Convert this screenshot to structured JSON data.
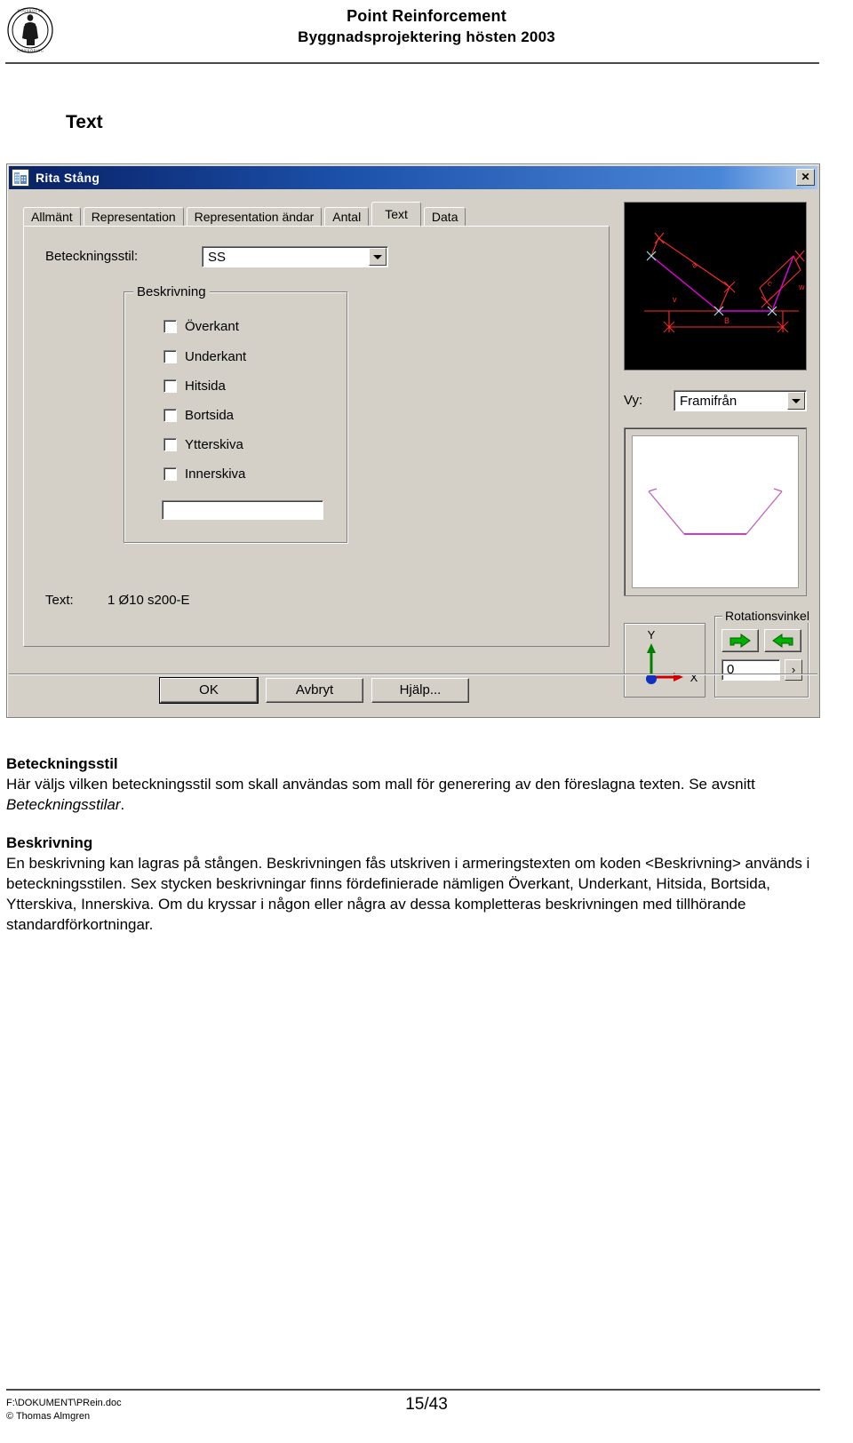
{
  "header": {
    "title_line1": "Point Reinforcement",
    "title_line2": "Byggnadsprojektering hösten 2003",
    "logo_name": "university-seal-logo"
  },
  "section": {
    "heading": "Text"
  },
  "dialog": {
    "title": "Rita Stång",
    "close_label": "✕",
    "tabs": [
      {
        "label": "Allmänt",
        "active": false
      },
      {
        "label": "Representation",
        "active": false
      },
      {
        "label": "Representation ändar",
        "active": false
      },
      {
        "label": "Antal",
        "active": false
      },
      {
        "label": "Text",
        "active": true
      },
      {
        "label": "Data",
        "active": false
      }
    ],
    "style": {
      "label": "Beteckningsstil:",
      "value": "SS",
      "placeholder": ""
    },
    "beskrivning": {
      "legend": "Beskrivning",
      "checkboxes": [
        {
          "label": "Överkant",
          "checked": false
        },
        {
          "label": "Underkant",
          "checked": false
        },
        {
          "label": "Hitsida",
          "checked": false
        },
        {
          "label": "Bortsida",
          "checked": false
        },
        {
          "label": "Ytterskiva",
          "checked": false
        },
        {
          "label": "Innerskiva",
          "checked": false
        }
      ],
      "input_value": "",
      "input_placeholder": ""
    },
    "text_preview": {
      "label": "Text:",
      "value": "1 Ø10 s200-E"
    },
    "buttons": [
      {
        "label": "OK",
        "default": true
      },
      {
        "label": "Avbryt",
        "default": false
      },
      {
        "label": "Hjälp...",
        "default": false
      }
    ],
    "view": {
      "label": "Vy:",
      "value": "Framifrån"
    },
    "rotation": {
      "legend": "Rotationsvinkel",
      "value": "0",
      "more_label": "›",
      "cw_name": "rotate-clockwise-icon",
      "ccw_name": "rotate-counterclockwise-icon"
    },
    "axis": {
      "y_label": "Y",
      "x_label": "X"
    },
    "colors": {
      "dialog_face": "#d4d0c8",
      "titlebar_start": "#0a246a",
      "titlebar_end": "#a6c8f0",
      "preview_bg": "#000000",
      "bar_red": "#ff0000",
      "bar_magenta": "#ff00ff",
      "node_cyan": "#9fe8e0",
      "arrow_green": "#00a000"
    }
  },
  "body": {
    "sections": [
      {
        "heading": "Beteckningsstil",
        "paragraph_before_italic": "Här väljs vilken beteckningsstil som skall användas som mall för generering av den föreslagna texten. Se avsnitt ",
        "italic_term": "Beteckningsstilar",
        "paragraph_after_italic": "."
      },
      {
        "heading": "Beskrivning",
        "paragraph": "En beskrivning kan lagras på stången. Beskrivningen fås utskriven i armeringstexten om koden <Beskrivning> används i beteckningsstilen. Sex stycken beskrivningar finns fördefinierade nämligen Överkant, Underkant, Hitsida, Bortsida, Ytterskiva, Innerskiva. Om du kryssar i någon eller några av dessa kompletteras beskrivningen med tillhörande standardförkortningar."
      }
    ]
  },
  "footer": {
    "file_path": "F:\\DOKUMENT\\PRein.doc",
    "copyright": "© Thomas Almgren",
    "page": "15/43"
  }
}
